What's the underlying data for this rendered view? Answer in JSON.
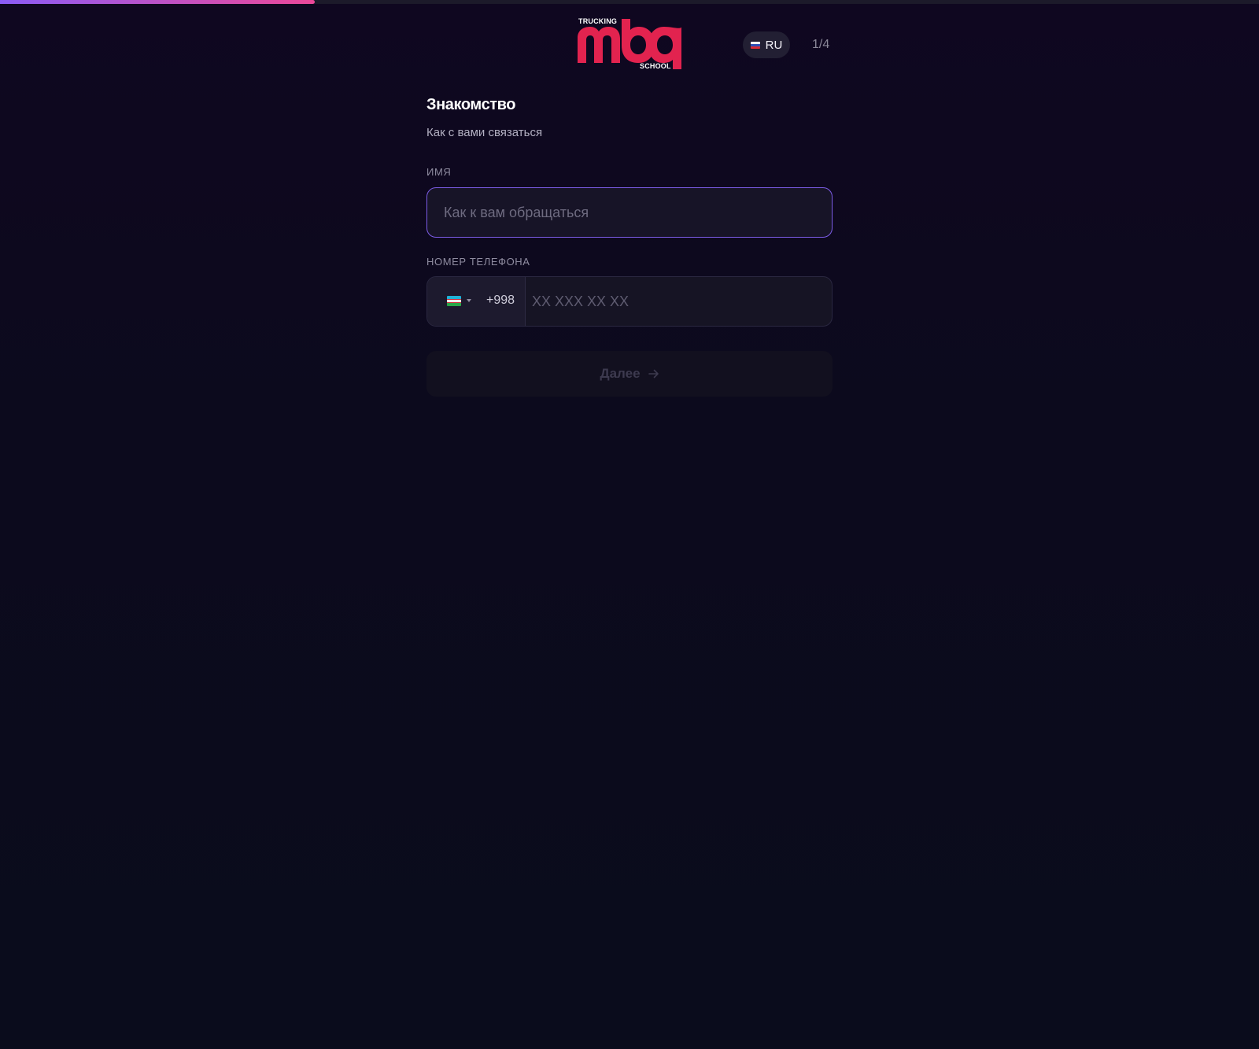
{
  "progress": {
    "fraction": 0.25
  },
  "header": {
    "logo": {
      "wordmark": "mba",
      "top_text": "TRUCKING",
      "bottom_text": "SCHOOL",
      "color": "#e2234f"
    },
    "language": {
      "code": "RU",
      "flag": "russia-flag-icon"
    },
    "step_counter": "1/4"
  },
  "form": {
    "title": "Знакомство",
    "subtitle": "Как с вами связаться",
    "name_field": {
      "label": "ИМЯ",
      "placeholder": "Как к вам обращаться",
      "value": ""
    },
    "phone_field": {
      "label": "НОМЕР ТЕЛЕФОНА",
      "country_flag": "uzbekistan-flag-icon",
      "dial_code": "+998",
      "placeholder": "XX XXX XX XX",
      "value": ""
    },
    "next_button": {
      "label": "Далее",
      "icon": "arrow-right-icon",
      "disabled": true
    }
  },
  "colors": {
    "accent": "#7c5ce6",
    "progress_start": "#8b5cf6",
    "progress_end": "#ec4899",
    "background": "#0c0a1d"
  }
}
